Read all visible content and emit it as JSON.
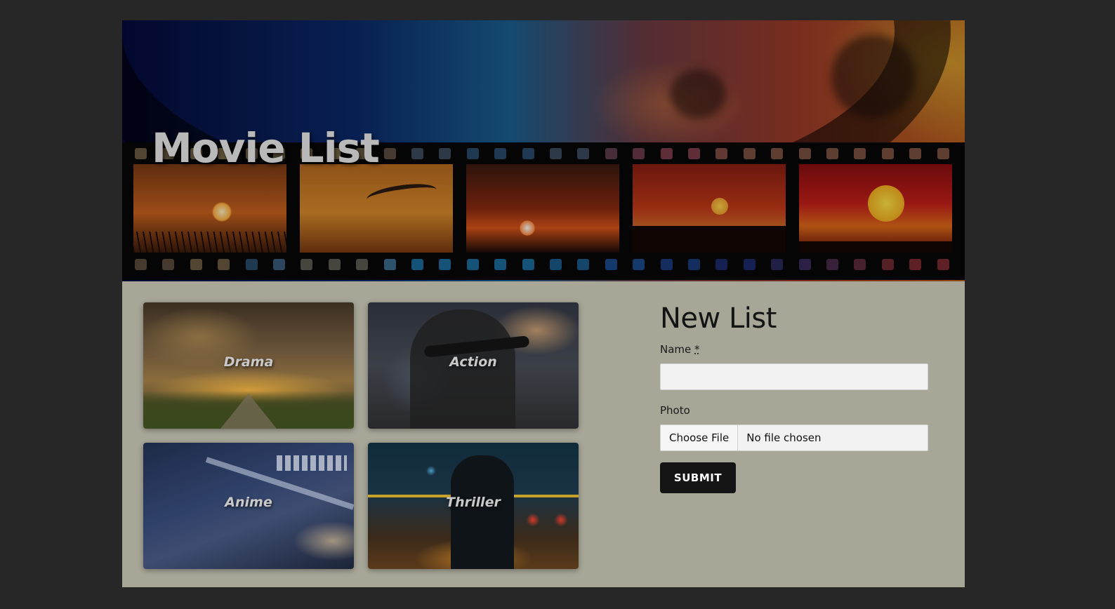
{
  "header": {
    "title": "Movie List"
  },
  "categories": [
    {
      "label": "Drama"
    },
    {
      "label": "Action"
    },
    {
      "label": "Anime"
    },
    {
      "label": "Thriller"
    }
  ],
  "form": {
    "heading": "New List",
    "name_label": "Name",
    "required_marker": "*",
    "name_value": "",
    "photo_label": "Photo",
    "file_button_label": "Choose File",
    "file_status": "No file chosen",
    "submit_label": "SUBMIT"
  },
  "colors": {
    "page_background": "#272727",
    "content_background": "#a7a697",
    "submit_background": "#151515",
    "title_color": "#b9b9b9"
  }
}
